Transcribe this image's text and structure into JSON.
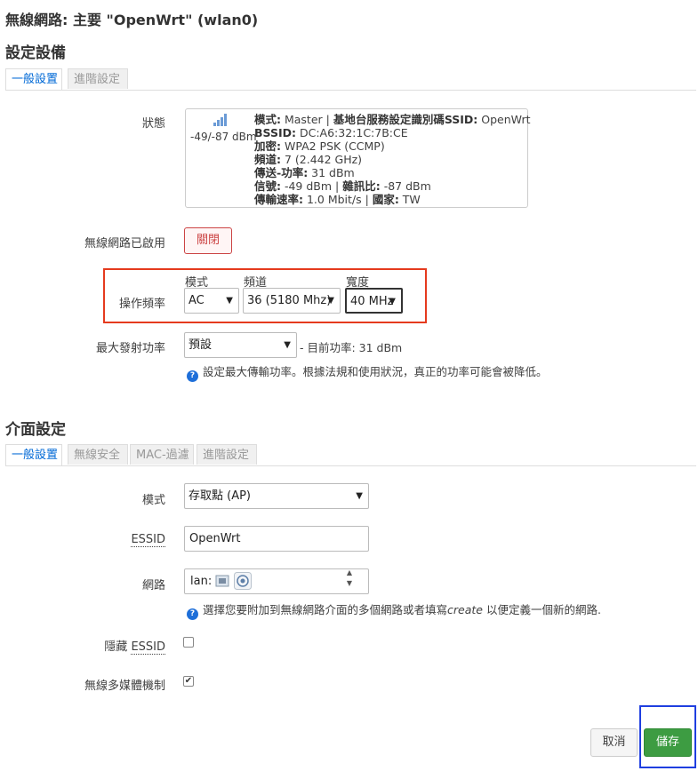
{
  "page_title": "無線網路: 主要 \"OpenWrt\" (wlan0)",
  "device_section": {
    "title": "設定設備",
    "tabs": [
      {
        "label": "一般設置",
        "active": true
      },
      {
        "label": "進階設定",
        "active": false
      }
    ]
  },
  "status": {
    "label": "狀態",
    "signal_icon": "signal-bars-icon",
    "signal_text": "-49/-87 dBm",
    "lines": [
      {
        "parts": [
          {
            "k": "模式:",
            "v": " Master | "
          },
          {
            "k": "基地台服務設定識別碼SSID:",
            "v": " OpenWrt"
          }
        ]
      },
      {
        "parts": [
          {
            "k": "BSSID:",
            "v": " DC:A6:32:1C:7B:CE"
          }
        ]
      },
      {
        "parts": [
          {
            "k": "加密:",
            "v": " WPA2 PSK (CCMP)"
          }
        ]
      },
      {
        "parts": [
          {
            "k": "頻道:",
            "v": " 7 (2.442 GHz)"
          }
        ]
      },
      {
        "parts": [
          {
            "k": "傳送-功率:",
            "v": " 31 dBm"
          }
        ]
      },
      {
        "parts": [
          {
            "k": "信號:",
            "v": " -49 dBm | "
          },
          {
            "k": "雜訊比:",
            "v": " -87 dBm"
          }
        ]
      },
      {
        "parts": [
          {
            "k": "傳輸速率:",
            "v": " 1.0 Mbit/s | "
          },
          {
            "k": "國家:",
            "v": " TW"
          }
        ]
      }
    ]
  },
  "wireless_enabled": {
    "label": "無線網路已啟用",
    "button_label": "關閉",
    "color": "#cc4444"
  },
  "op_freq": {
    "label": "操作頻率",
    "mode_label": "模式",
    "mode_value": "AC",
    "channel_label": "頻道",
    "channel_value": "36 (5180 Mhz)",
    "width_label": "寬度",
    "width_value": "40 MHz"
  },
  "tx_power": {
    "label": "最大發射功率",
    "value": "預設",
    "current": "- 目前功率: 31 dBm",
    "hint": "設定最大傳輸功率。根據法規和使用狀況，真正的功率可能會被降低。"
  },
  "interface_section": {
    "title": "介面設定",
    "tabs": [
      {
        "label": "一般設置",
        "active": true
      },
      {
        "label": "無線安全",
        "active": false
      },
      {
        "label": "MAC-過濾",
        "active": false
      },
      {
        "label": "進階設定",
        "active": false
      }
    ]
  },
  "mode": {
    "label": "模式",
    "value": "存取點 (AP)"
  },
  "essid": {
    "label": "ESSID",
    "value": "OpenWrt"
  },
  "network": {
    "label": "網路",
    "value": "lan:",
    "hint_before": "選擇您要附加到無線網路介面的多個網路或者填寫",
    "hint_em": "create",
    "hint_after": " 以便定義一個新的網路."
  },
  "hide_essid": {
    "label_prefix": "隱藏 ",
    "label_abbr": "ESSID",
    "checked": false
  },
  "wmm": {
    "label": "無線多媒體機制",
    "checked": true,
    "check_mark": "✔"
  },
  "buttons": {
    "cancel": "取消",
    "save": "儲存",
    "save_color": "#3d9c42"
  },
  "highlight_colors": {
    "red": "#e53a1e",
    "blue": "#1f3fe0"
  }
}
